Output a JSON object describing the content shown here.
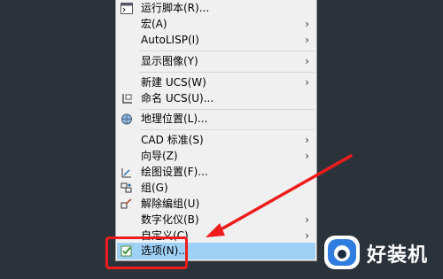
{
  "menu": {
    "items": [
      {
        "label": "运行脚本(R)...",
        "arrow": ""
      },
      {
        "label": "宏(A)",
        "arrow": "›"
      },
      {
        "label": "AutoLISP(I)",
        "arrow": "›"
      },
      {
        "label": "显示图像(Y)",
        "arrow": "›"
      },
      {
        "label": "新建 UCS(W)",
        "arrow": "›"
      },
      {
        "label": "命名 UCS(U)...",
        "arrow": ""
      },
      {
        "label": "地理位置(L)...",
        "arrow": ""
      },
      {
        "label": "CAD 标准(S)",
        "arrow": "›"
      },
      {
        "label": "向导(Z)",
        "arrow": "›"
      },
      {
        "label": "绘图设置(F)...",
        "arrow": ""
      },
      {
        "label": "组(G)",
        "arrow": ""
      },
      {
        "label": "解除编组(U)",
        "arrow": ""
      },
      {
        "label": "数字化仪(B)",
        "arrow": "›"
      },
      {
        "label": "自定义(C)",
        "arrow": "›"
      },
      {
        "label": "选项(N)...",
        "arrow": ""
      }
    ]
  },
  "watermark": {
    "text": "好装机"
  },
  "colors": {
    "highlight": "#9fd0f6",
    "annotation": "#ee1c1c",
    "background": "#2c323a"
  }
}
